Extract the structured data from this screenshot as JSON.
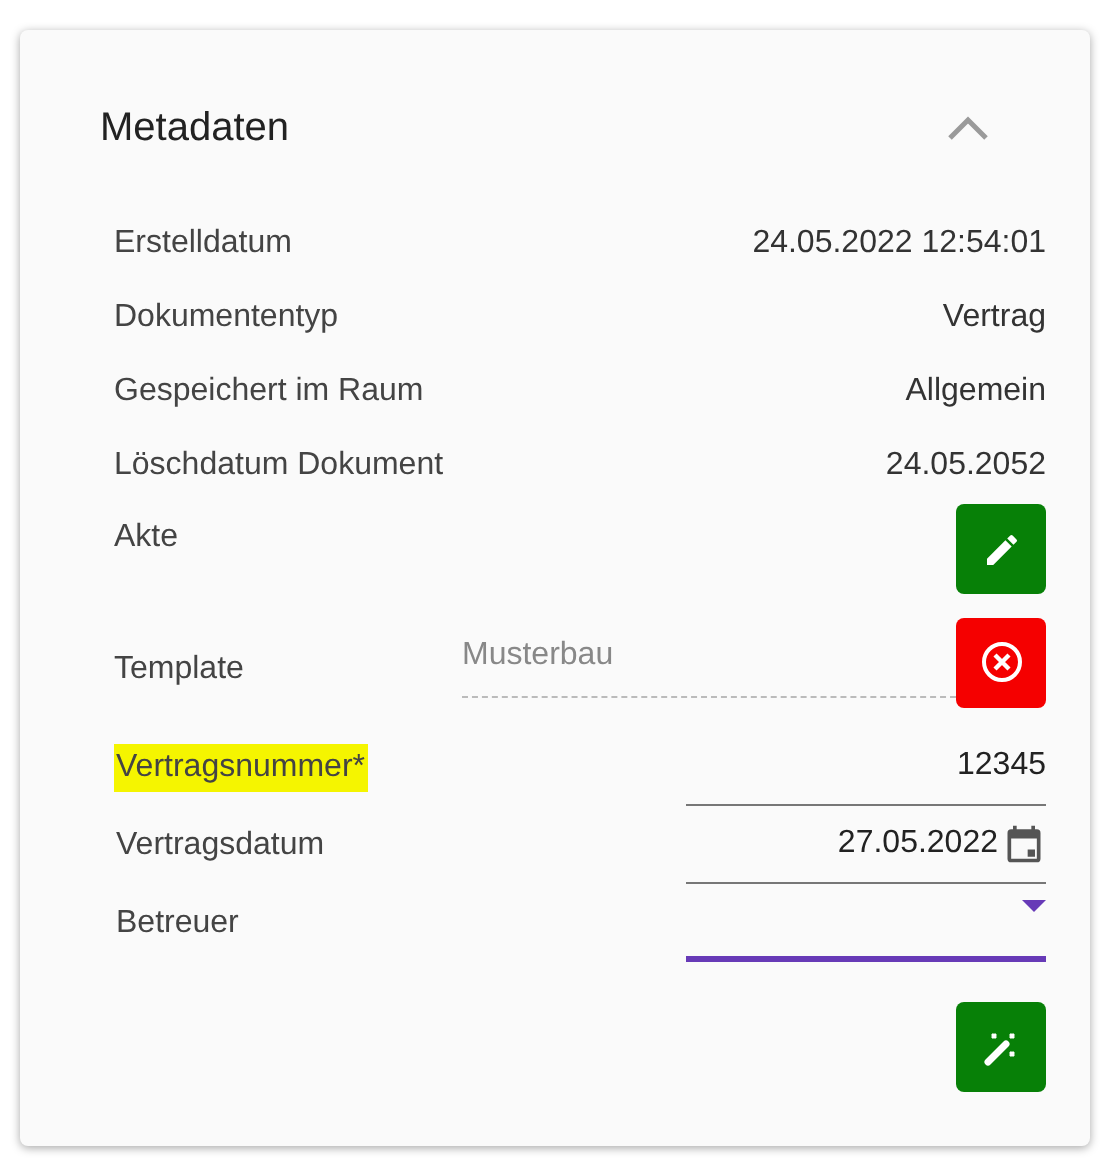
{
  "panel": {
    "title": "Metadaten",
    "expanded": true
  },
  "info_rows": [
    {
      "label": "Erstelldatum",
      "value": "24.05.2022 12:54:01"
    },
    {
      "label": "Dokumententyp",
      "value": "Vertrag"
    },
    {
      "label": "Gespeichert im Raum",
      "value": "Allgemein"
    },
    {
      "label": "Löschdatum Dokument",
      "value": "24.05.2052"
    }
  ],
  "akte": {
    "label": "Akte"
  },
  "template": {
    "label": "Template",
    "value": "Musterbau"
  },
  "fields": [
    {
      "kind": "text",
      "label": "Vertragsnummer*",
      "value": "12345",
      "highlighted": true,
      "focused": false
    },
    {
      "kind": "date",
      "label": "Vertragsdatum",
      "value": "27.05.2022",
      "highlighted": false,
      "focused": false
    },
    {
      "kind": "select",
      "label": "Betreuer",
      "highlighted": false,
      "focused": true
    }
  ]
}
